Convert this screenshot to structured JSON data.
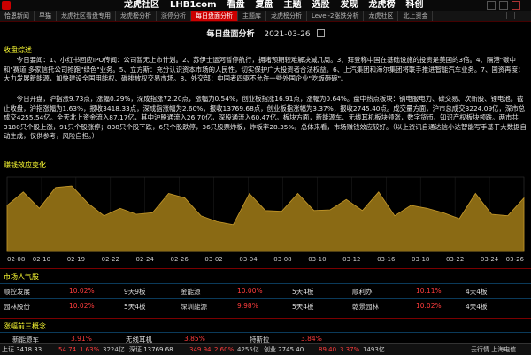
{
  "app": {
    "nav": [
      "龙虎社区",
      "LHB1com",
      "看盘",
      "复盘",
      "主题",
      "选股",
      "发现",
      "龙虎榜",
      "科创"
    ]
  },
  "tabs": [
    "恰恩新闻",
    "早猫",
    "龙虎社区看盘专用",
    "龙虎榜分析",
    "涨停分析",
    "每日盘面分析",
    "主题库",
    "龙虎榜分析",
    "Level-2涨跌分析",
    "龙虎社区",
    "北上资金"
  ],
  "active_tab": 5,
  "page": {
    "title": "每日盘面分析",
    "date": "2021-03-26"
  },
  "summary": {
    "title": "收盘综述",
    "paragraphs": [
      "今日要闻：1、小红书回应IPO传闻：公司暂无上市计划。2、苏伊士运河暂停航行，拥堵预期较难解决减几周。3、拜登称中国在基础设施的投资是美国的3倍。4、隔港\"碳中和\"赛道 多家信托公司抢跑\"绿色\"业务。5、立方斯：充分认识资本市场的人民性，切实保护广大投资者合法权益。6、上汽集团和海尔集团将联手推进智能汽车业务。7、国资再度：大力发展新能源，加快建设全国用能权、碳排放权交易市场。8、外交部：中国者四驱不允许一些外国企业\"吃饭砸碗\"。",
      "今日开盘，沪指涨9.73点，涨幅0.29%，深成指涨72.20点，涨幅为0.54%，创业板指涨16.91点，涨幅为0.64%。盘中热点板块：钠电服电力、碳交易、次新股、锂电池。截止收盘，沪指涨幅为1.63%，报收3418.33点，深成指涨幅为2.60%，报收13769.68点，创业板指涨幅为3.37%，报收2745.40点。成交量方面，沪市总成交3224.09亿，深市总成交4255.54亿。全天北上资金流入87.17亿，其中沪股通流入26.70亿，深股通流入60.47亿。板块方面，新能源车、无线耳机板块领涨，数字货币、知识产权板块领跌。两市共3180只个股上涨，91只个股涨停；838只个股下跌，6只个股跌停，36只股票炸板，炸板率28.35%。总体来看，市场赚钱效应较好。（以上资讯自通达信小达智能写手基于大数据自动生成，仅供参考，风险自担。）"
    ]
  },
  "effect_chart": {
    "title": "赚钱效应变化",
    "chart_data": {
      "type": "area",
      "x": [
        "02-08",
        "02-10",
        "02-19",
        "02-22",
        "02-24",
        "02-26",
        "03-02",
        "03-04",
        "03-08",
        "03-10",
        "03-12",
        "03-16",
        "03-18",
        "03-22",
        "03-24",
        "03-26"
      ],
      "values": [
        62,
        80,
        58,
        86,
        88,
        65,
        48,
        58,
        50,
        52,
        78,
        72,
        48,
        40,
        36,
        78,
        55,
        54,
        78,
        55,
        56,
        70,
        55,
        80,
        48,
        62,
        58,
        52,
        44,
        78,
        50,
        48,
        72
      ],
      "ylim": [
        0,
        100
      ]
    }
  },
  "market": {
    "title": "市场人气股",
    "rows": [
      [
        {
          "name": "顺控发展",
          "pct": "10.02%",
          "board": "9天9板"
        },
        {
          "name": "金能源",
          "pct": "10.00%",
          "board": "5天4板"
        },
        {
          "name": "顺利办",
          "pct": "10.11%",
          "board": "4天4板"
        }
      ],
      [
        {
          "name": "园林股份",
          "pct": "10.02%",
          "board": "5天4板"
        },
        {
          "name": "深圳能源",
          "pct": "9.98%",
          "board": "5天4板"
        },
        {
          "name": "乾景园林",
          "pct": "10.02%",
          "board": "4天4板"
        }
      ]
    ]
  },
  "concept": {
    "title": "涨幅前三概念",
    "items": [
      {
        "name": "新能源车",
        "pct": "3.91%"
      },
      {
        "name": "无线耳机",
        "pct": "3.85%"
      },
      {
        "name": "特斯拉",
        "pct": "3.84%"
      }
    ]
  },
  "statusbar": {
    "items": [
      "上证 3418.33",
      "54.74",
      "1.63%",
      "3224亿",
      "深证 13769.68",
      "349.94",
      "2.60%",
      "4255亿",
      "创业 2745.40",
      "89.40",
      "3.37%",
      "1493亿",
      "云行情 上海电信"
    ]
  },
  "colors": {
    "red": "#ff3c3c",
    "yellow": "#ffff33",
    "brand": "#cc0000"
  }
}
